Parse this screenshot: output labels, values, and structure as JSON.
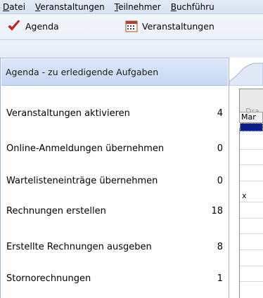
{
  "menubar": {
    "items": [
      {
        "accel": "D",
        "rest": "atei"
      },
      {
        "accel": "V",
        "rest": "eranstaltungen"
      },
      {
        "accel": "T",
        "rest": "eilnehmer"
      },
      {
        "accel": "B",
        "rest": "uchführu"
      }
    ]
  },
  "toolbar": {
    "agenda_label": "Agenda",
    "veranstaltungen_label": "Veranstaltungen"
  },
  "agenda": {
    "title": "Agenda - zu erledigende Aufgaben",
    "tasks": [
      {
        "label": "Veranstaltungen aktivieren",
        "count": "4"
      },
      {
        "label": "Online-Anmeldungen übernehmen",
        "count": "0"
      },
      {
        "label": "Wartelisteneinträge übernehmen",
        "count": "0"
      },
      {
        "label": "Rechnungen erstellen",
        "count": "18"
      },
      {
        "label": "Erstellte Rechnungen ausgeben",
        "count": "8"
      },
      {
        "label": "Stornorechnungen",
        "count": "1"
      }
    ]
  },
  "grid": {
    "drag_hint": "Dra",
    "column_header": "Mar",
    "row_mark": "x"
  },
  "colors": {
    "menubar_bg": "#d6e2f3",
    "panel_header_bg": "#c6d8f3",
    "selection": "#0a1e8c",
    "check": "#d42020"
  }
}
